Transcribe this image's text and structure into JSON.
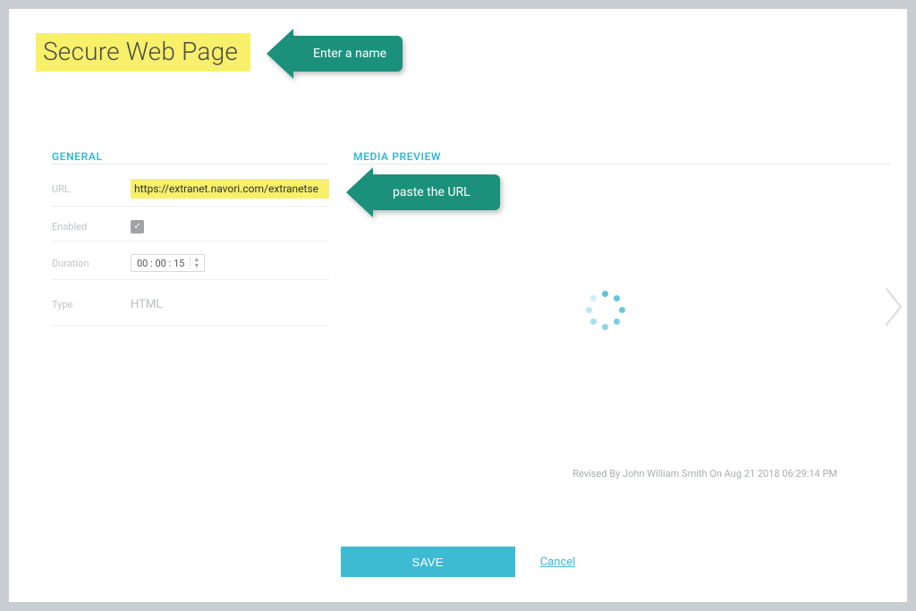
{
  "title": "Secure Web Page",
  "tooltips": {
    "name": "Enter a name",
    "url": "paste the URL"
  },
  "sections": {
    "general": "GENERAL",
    "media_preview": "MEDIA PREVIEW"
  },
  "form": {
    "url_label": "URL",
    "url_value": "https://extranet.navori.com/extranetse",
    "enabled_label": "Enabled",
    "enabled_checked": true,
    "duration_label": "Duration",
    "duration_value": "00 : 00 : 15",
    "type_label": "Type",
    "type_value": "HTML"
  },
  "revised_by": "Revised By John William Smith On Aug 21 2018 06:29:14 PM",
  "actions": {
    "save": "SAVE",
    "cancel": "Cancel"
  },
  "icons": {
    "checkbox_check": "✓",
    "spinner_up": "▲",
    "spinner_down": "▼"
  }
}
